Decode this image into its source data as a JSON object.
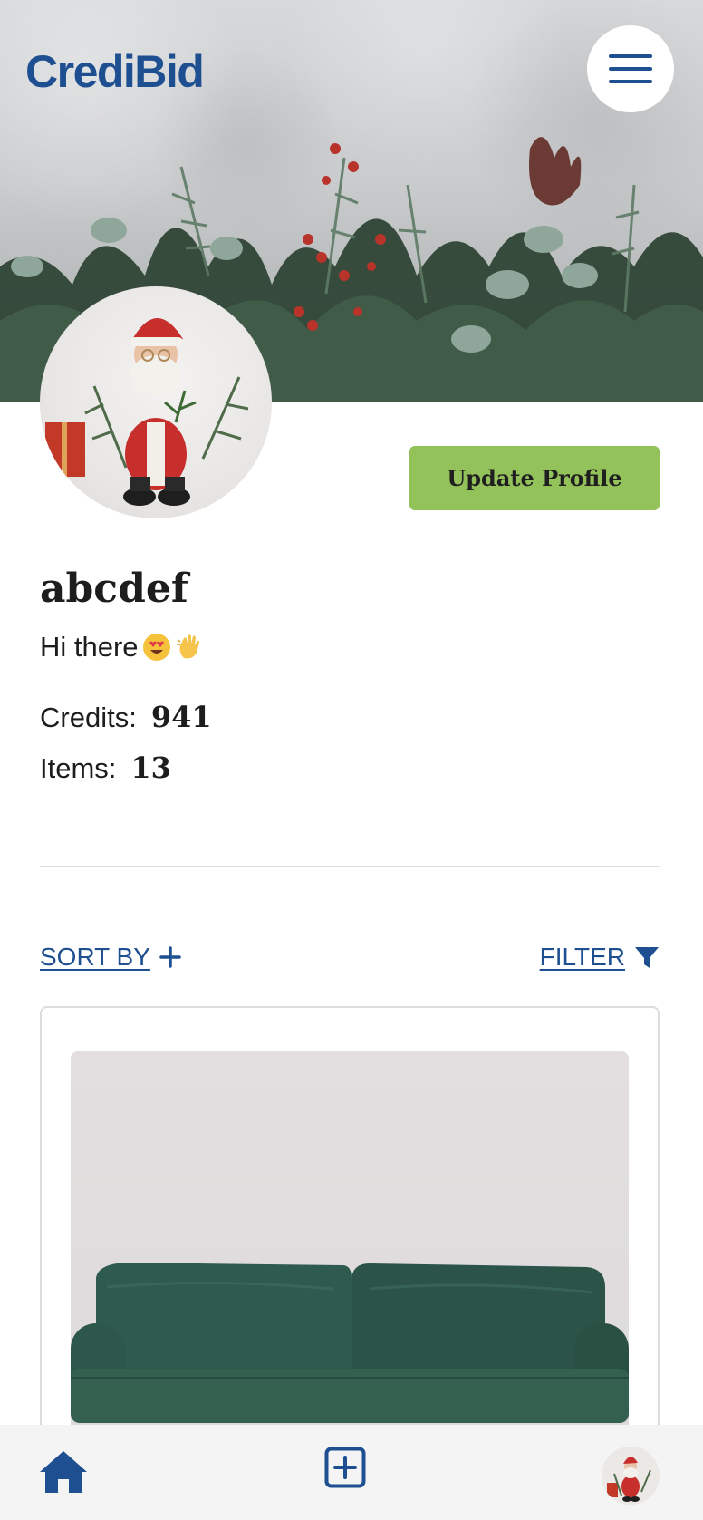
{
  "header": {
    "logo_text": "CrediBid",
    "menu_icon": "hamburger-menu-icon"
  },
  "profile": {
    "update_button_label": "Update Profile",
    "username": "abcdef",
    "bio": "Hi there",
    "bio_emojis": [
      "heart-eyes-emoji",
      "waving-hand-emoji"
    ],
    "credits_label": "Credits:",
    "credits_value": "941",
    "items_label": "Items:",
    "items_value": "13"
  },
  "controls": {
    "sort_label": "SORT BY",
    "sort_icon": "plus-icon",
    "filter_label": "FILTER",
    "filter_icon": "funnel-icon"
  },
  "bottom_nav": {
    "items": [
      {
        "name": "home",
        "icon": "home-icon"
      },
      {
        "name": "add-item",
        "icon": "plus-square-icon"
      },
      {
        "name": "profile",
        "icon": "avatar"
      }
    ]
  },
  "colors": {
    "brand": "#1e4f91",
    "accent_green": "#93c15a",
    "nav_bg": "#f4f4f5"
  }
}
